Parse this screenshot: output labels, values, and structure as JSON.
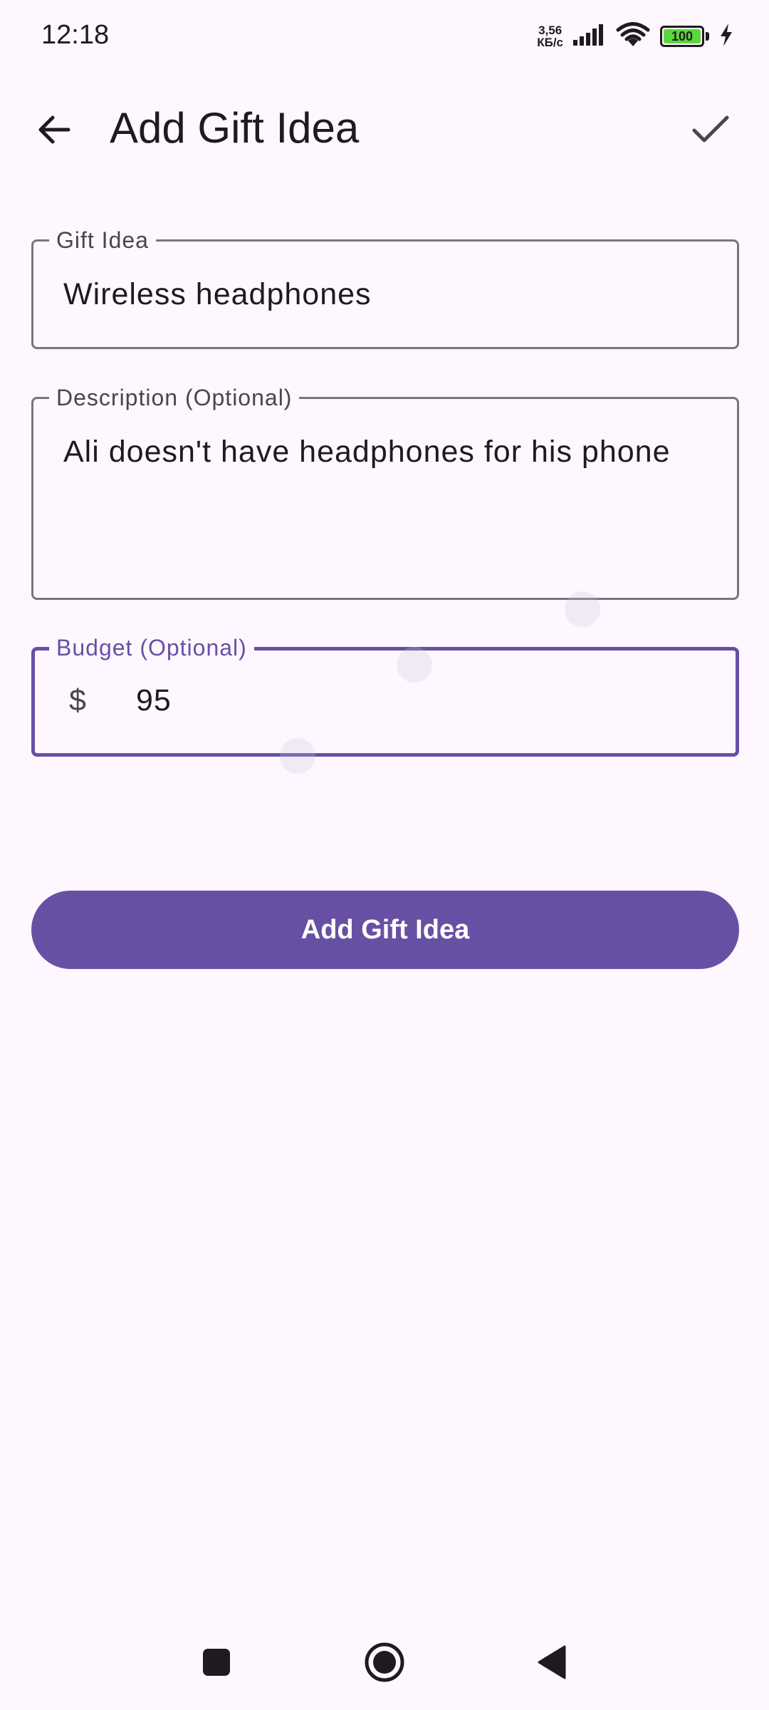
{
  "status_bar": {
    "time": "12:18",
    "net_speed_value": "3,56",
    "net_speed_unit": "КБ/с",
    "battery_level": "100",
    "signal_icon": "signal-bars-icon",
    "wifi_icon": "wifi-icon",
    "charging_icon": "charging-bolt-icon"
  },
  "app_bar": {
    "title": "Add Gift Idea",
    "back_icon": "arrow-back-icon",
    "confirm_icon": "check-icon"
  },
  "form": {
    "gift_idea": {
      "label": "Gift Idea",
      "value": "Wireless headphones"
    },
    "description": {
      "label": "Description (Optional)",
      "value": "Ali doesn't have headphones for his phone"
    },
    "budget": {
      "label": "Budget (Optional)",
      "prefix": "$",
      "value": "95",
      "focused": true
    }
  },
  "submit_button": {
    "label": "Add Gift Idea"
  },
  "nav_bar": {
    "recents_icon": "square-recents-icon",
    "home_icon": "circle-home-icon",
    "back_icon": "triangle-back-icon"
  },
  "colors": {
    "background": "#fef7ff",
    "primary": "#6750a4",
    "outline": "#79747e",
    "text": "#1d1b20",
    "label": "#49454f",
    "battery_fill": "#5ad83b"
  }
}
